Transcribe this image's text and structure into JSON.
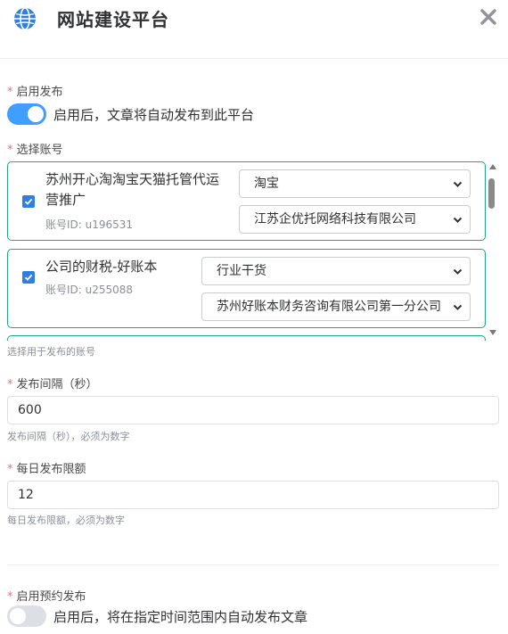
{
  "header": {
    "title": "网站建设平台",
    "icon": "globe-icon",
    "close_icon": "close-icon",
    "accent": "#2f7fe0"
  },
  "auto_publish": {
    "required_mark": "*",
    "label": "启用发布",
    "enabled": true,
    "description": "启用后，文章将自动发布到此平台"
  },
  "accounts": {
    "required_mark": "*",
    "label": "选择账号",
    "items": [
      {
        "name": "苏州开心淘淘宝天猫托管代运营推广",
        "account_id": "账号ID: u196531",
        "checked": true,
        "category": "淘宝",
        "company": "江苏企优托网络科技有限公司"
      },
      {
        "name": "公司的财税-好账本",
        "account_id": "账号ID: u255088",
        "checked": true,
        "category": "行业干货",
        "company": "苏州好账本财务咨询有限公司第一分公司"
      }
    ],
    "hint": "选择用于发布的账号"
  },
  "interval": {
    "required_mark": "*",
    "label": "发布间隔（秒）",
    "value": "600",
    "hint": "发布间隔（秒），必须为数字"
  },
  "daily_limit": {
    "required_mark": "*",
    "label": "每日发布限额",
    "value": "12",
    "hint": "每日发布限额，必须为数字"
  },
  "scheduled": {
    "required_mark": "*",
    "label": "启用预约发布",
    "enabled": false,
    "description": "启用后，将在指定时间范围内自动发布文章"
  },
  "colors": {
    "switch_on": "#409eff",
    "switch_off": "#dcdfe6",
    "card_border": "#1fa58a",
    "required": "#f56c6c"
  }
}
